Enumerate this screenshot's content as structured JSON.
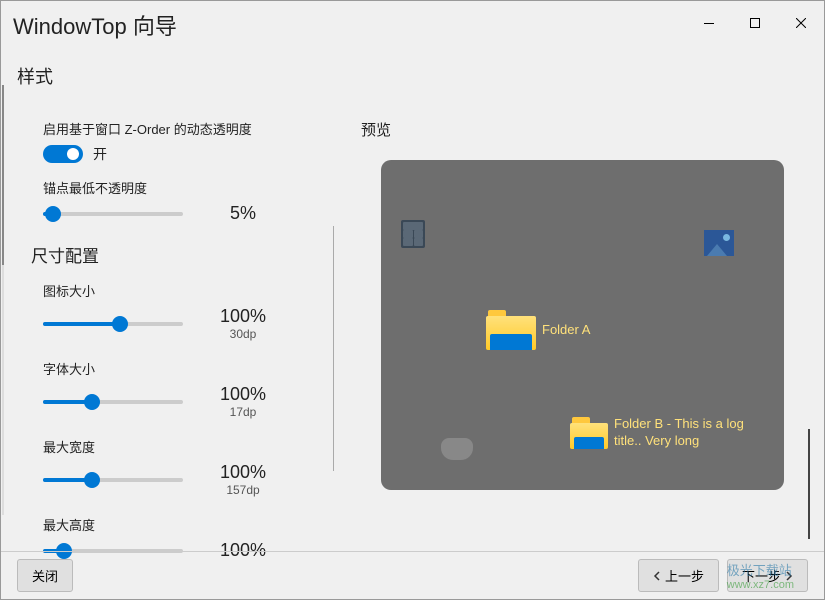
{
  "window": {
    "title": "WindowTop 向导"
  },
  "section": {
    "title": "样式"
  },
  "settings": {
    "zorder_label": "启用基于窗口 Z-Order 的动态透明度",
    "toggle_on_label": "开",
    "anchor_opacity_label": "锚点最低不透明度",
    "anchor_opacity_value": "5%",
    "size_config_header": "尺寸配置",
    "icon_size_label": "图标大小",
    "icon_size_value": "100%",
    "icon_size_sub": "30dp",
    "font_size_label": "字体大小",
    "font_size_value": "100%",
    "font_size_sub": "17dp",
    "max_width_label": "最大宽度",
    "max_width_value": "100%",
    "max_width_sub": "157dp",
    "max_height_label": "最大高度",
    "max_height_value": "100%"
  },
  "preview": {
    "title": "预览",
    "folder_a": "Folder A",
    "folder_b": "Folder B - This is a log title.. Very long"
  },
  "footer": {
    "close": "关闭",
    "prev": "上一步",
    "next": "下一步"
  },
  "watermark": {
    "label": "极光下载站",
    "url": "www.xz7.com"
  }
}
